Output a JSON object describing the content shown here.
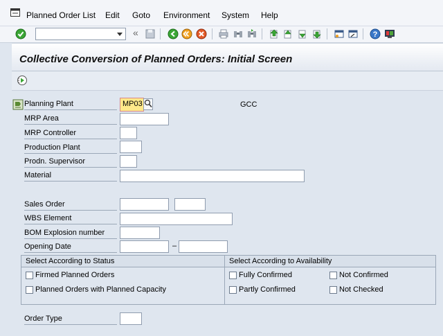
{
  "menu": {
    "items": [
      "Planned Order List",
      "Edit",
      "Goto",
      "Environment",
      "System",
      "Help"
    ]
  },
  "toolbar": {
    "command_value": "",
    "icons": [
      "enter-icon",
      "back-icon",
      "exit-icon",
      "cancel-icon",
      "print-icon",
      "find-icon",
      "find-next-icon",
      "first-page-icon",
      "prev-page-icon",
      "next-page-icon",
      "last-page-icon",
      "create-session-icon",
      "shortcut-icon",
      "help-icon",
      "layout-icon"
    ]
  },
  "title": "Collective Conversion of Planned Orders: Initial Screen",
  "form": {
    "planning_plant": {
      "label": "Planning Plant",
      "value": "MP03",
      "description": "GCC"
    },
    "mrp_area": {
      "label": "MRP Area",
      "value": ""
    },
    "mrp_controller": {
      "label": "MRP Controller",
      "value": ""
    },
    "production_plant": {
      "label": "Production Plant",
      "value": ""
    },
    "prodn_supervisor": {
      "label": "Prodn. Supervisor",
      "value": ""
    },
    "material": {
      "label": "Material",
      "value": ""
    },
    "sales_order": {
      "label": "Sales Order",
      "value": "",
      "item": ""
    },
    "wbs_element": {
      "label": "WBS Element",
      "value": ""
    },
    "bom_explosion": {
      "label": "BOM Explosion number",
      "value": ""
    },
    "opening_date": {
      "label": "Opening Date",
      "from": "",
      "to": "",
      "separator": "–"
    },
    "order_type": {
      "label": "Order Type",
      "value": ""
    }
  },
  "status_group": {
    "title": "Select According to Status",
    "options": [
      "Firmed Planned Orders",
      "Planned Orders with Planned Capacity"
    ]
  },
  "availability_group": {
    "title": "Select According to Availability",
    "options": [
      "Fully Confirmed",
      "Partly Confirmed",
      "Not Confirmed",
      "Not Checked"
    ]
  }
}
